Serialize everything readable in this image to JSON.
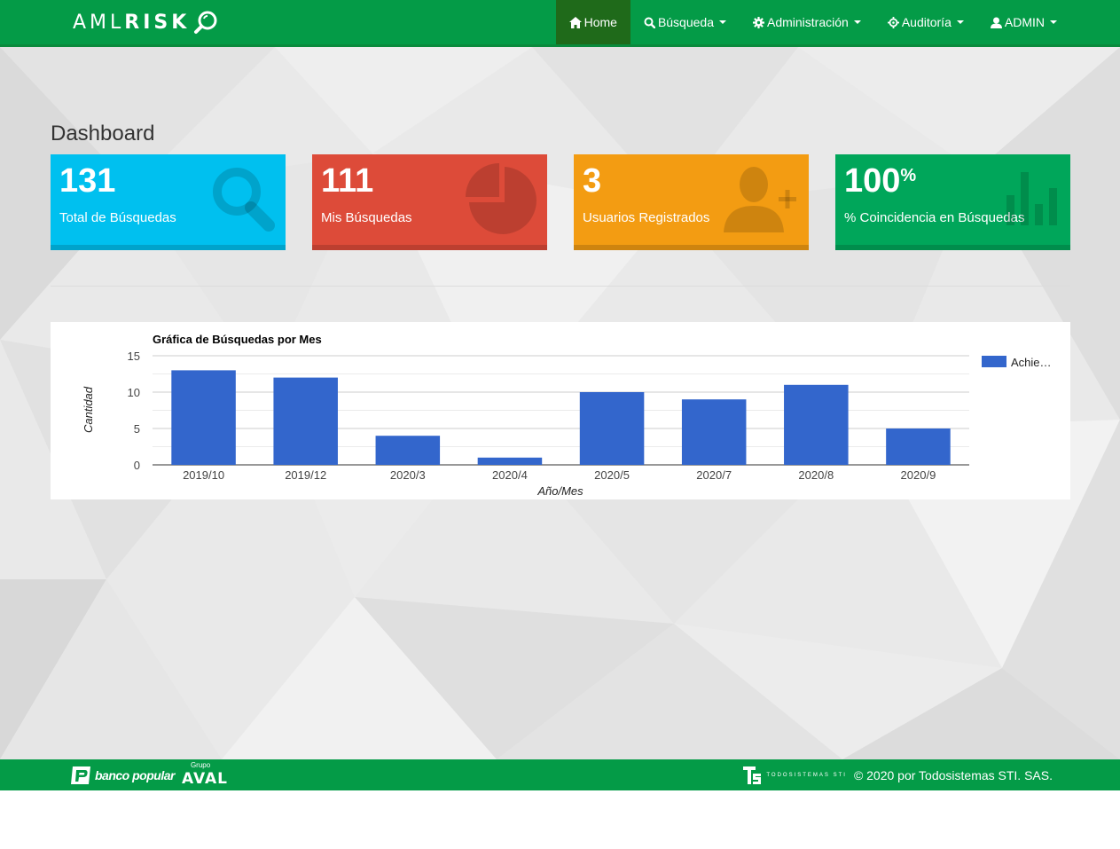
{
  "colors": {
    "brand_green": "#049b47",
    "nav_active": "#1f6a1a",
    "tile_aqua": "#00c0ef",
    "tile_red": "#dd4b39",
    "tile_yellow": "#f39c12",
    "tile_green": "#00a65a",
    "bar_color": "#3366cc"
  },
  "navbar": {
    "brand_light": "AML",
    "brand_bold": "RISK",
    "brand_icon": "magnifier-icon",
    "items": [
      {
        "label": "Home",
        "icon": "home-icon",
        "dropdown": false,
        "active": true
      },
      {
        "label": "Búsqueda",
        "icon": "search-icon",
        "dropdown": true,
        "active": false
      },
      {
        "label": "Administración",
        "icon": "gear-icon",
        "dropdown": true,
        "active": false
      },
      {
        "label": "Auditoría",
        "icon": "crosshair-icon",
        "dropdown": true,
        "active": false
      },
      {
        "label": "ADMIN",
        "icon": "user-icon",
        "dropdown": true,
        "active": false
      }
    ]
  },
  "page": {
    "title": "Dashboard"
  },
  "tiles": [
    {
      "value": "131",
      "suffix": "",
      "label": "Total de Búsquedas",
      "icon": "search-icon"
    },
    {
      "value": "111",
      "suffix": "",
      "label": "Mis Búsquedas",
      "icon": "pie-chart-icon"
    },
    {
      "value": "3",
      "suffix": "",
      "label": "Usuarios Registrados",
      "icon": "user-add-icon"
    },
    {
      "value": "100",
      "suffix": "%",
      "label": "% Coincidencia en Búsquedas",
      "icon": "bar-chart-icon"
    }
  ],
  "chart_data": {
    "type": "bar",
    "title": "Gráfica de Búsquedas por Mes",
    "xlabel": "Año/Mes",
    "ylabel": "Cantidad",
    "categories": [
      "2019/10",
      "2019/12",
      "2020/3",
      "2020/4",
      "2020/5",
      "2020/7",
      "2020/8",
      "2020/9"
    ],
    "series": [
      {
        "name": "Achie…",
        "values": [
          13,
          12,
          4,
          1,
          10,
          9,
          11,
          5
        ]
      }
    ],
    "ylim": [
      0,
      15
    ],
    "yticks": [
      0,
      5,
      10,
      15
    ],
    "grid": true,
    "legend": "right"
  },
  "footer": {
    "bank_name": "banco popular",
    "group_small": "Grupo",
    "group_name": "AVAL",
    "vendor_small": "TODOSISTEMAS STI",
    "copyright": "© 2020 por Todosistemas STI. SAS."
  }
}
